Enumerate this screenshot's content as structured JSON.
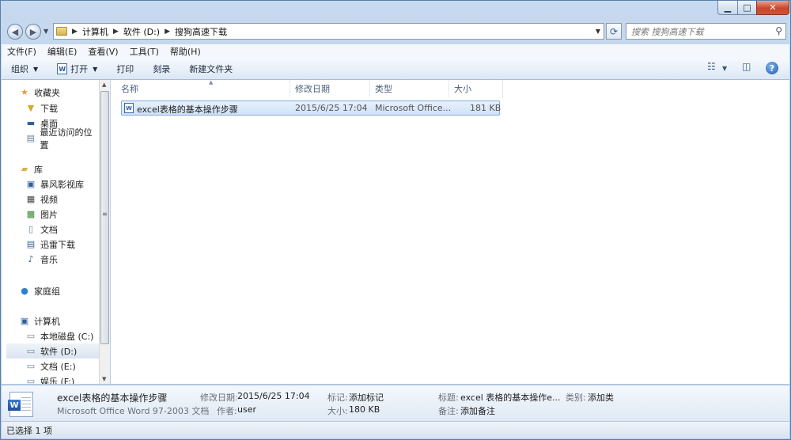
{
  "address": {
    "crumbs": [
      "计算机",
      "软件 (D:)",
      "搜狗高速下载"
    ]
  },
  "search": {
    "placeholder": "搜索 搜狗高速下载"
  },
  "menu": [
    "文件(F)",
    "编辑(E)",
    "查看(V)",
    "工具(T)",
    "帮助(H)"
  ],
  "toolbar": {
    "organize": "组织",
    "open": "打开",
    "print": "打印",
    "burn": "刻录",
    "new_folder": "新建文件夹"
  },
  "nav": {
    "favorites": "收藏夹",
    "downloads": "下载",
    "desktop": "桌面",
    "recent": "最近访问的位置",
    "libraries": "库",
    "baofeng": "暴风影视库",
    "videos": "视频",
    "pictures": "图片",
    "documents": "文档",
    "thunder": "迅雷下载",
    "music": "音乐",
    "homegroup": "家庭组",
    "computer": "计算机",
    "drive_c": "本地磁盘 (C:)",
    "drive_d": "软件 (D:)",
    "drive_e": "文档 (E:)",
    "drive_f": "娱乐 (F:)"
  },
  "columns": {
    "name": "名称",
    "modified": "修改日期",
    "type": "类型",
    "size": "大小"
  },
  "files": [
    {
      "name": "excel表格的基本操作步骤",
      "modified": "2015/6/25 17:04",
      "type": "Microsoft Office...",
      "size": "181 KB"
    }
  ],
  "details": {
    "title": "excel表格的基本操作步骤",
    "subtitle": "Microsoft Office Word 97-2003 文档",
    "modified_label": "修改日期:",
    "modified_value": "2015/6/25 17:04",
    "author_label": "作者:",
    "author_value": "user",
    "tags_label": "标记:",
    "tags_value": "添加标记",
    "size_label": "大小:",
    "size_value": "180 KB",
    "title_label": "标题:",
    "title_value": "excel 表格的基本操作e...",
    "comments_label": "备注:",
    "comments_value": "添加备注",
    "category_label": "类别:",
    "category_value": "添加类"
  },
  "status": {
    "text": "已选择 1 项"
  }
}
